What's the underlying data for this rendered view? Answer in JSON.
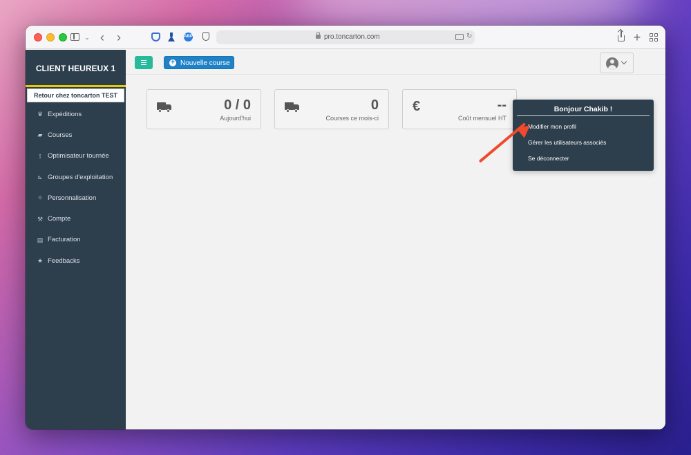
{
  "browser": {
    "url": "pro.toncarton.com"
  },
  "sidebar": {
    "brand": "CLIENT HEUREUX 1",
    "back_button": "Retour chez toncarton TEST",
    "items": [
      {
        "label": "Expéditions",
        "icon": "trophy-icon"
      },
      {
        "label": "Courses",
        "icon": "truck-icon"
      },
      {
        "label": "Optimisateur tournée",
        "icon": "route-icon"
      },
      {
        "label": "Groupes d'exploitation",
        "icon": "dolly-icon"
      },
      {
        "label": "Personnalisation",
        "icon": "magic-icon"
      },
      {
        "label": "Compte",
        "icon": "wrench-icon"
      },
      {
        "label": "Facturation",
        "icon": "file-icon"
      },
      {
        "label": "Feedbacks",
        "icon": "star-icon"
      }
    ]
  },
  "topbar": {
    "new_course_label": "Nouvelle course"
  },
  "stats": [
    {
      "value": "0 / 0",
      "label": "Aujourd'hui",
      "icon": "truck-icon"
    },
    {
      "value": "0",
      "label": "Courses ce mois-ci",
      "icon": "truck-icon"
    },
    {
      "value": "--",
      "label": "Coût mensuel HT",
      "icon": "euro-icon",
      "symbol": "€"
    }
  ],
  "user_menu": {
    "greeting": "Bonjour Chakib !",
    "items": [
      "Modifier mon profil",
      "Gérer les utilisateurs associés",
      "Se déconnecter"
    ]
  },
  "colors": {
    "sidebar": "#2d3e4d",
    "accent_yellow": "#e5cc00",
    "menu_toggle": "#26b99a",
    "primary_button": "#1f82c7",
    "annotation_arrow": "#ef4a2c"
  }
}
